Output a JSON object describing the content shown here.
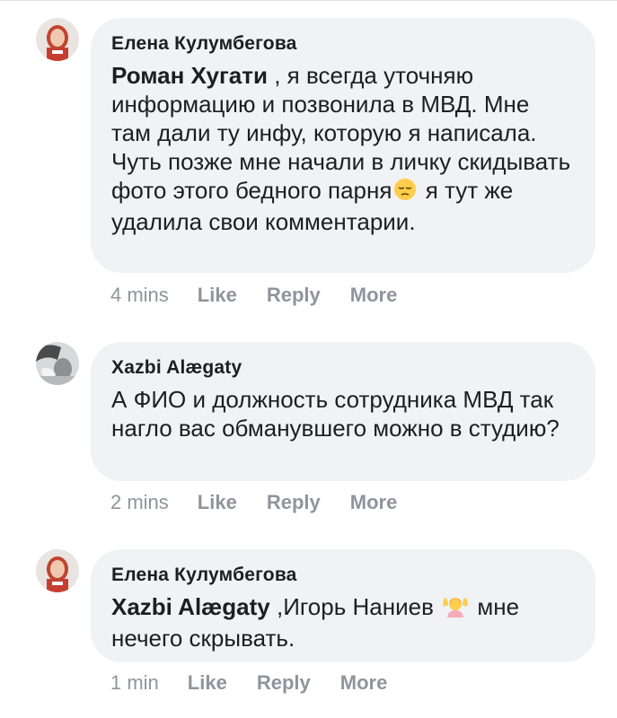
{
  "comments": [
    {
      "author": "Елена Кулумбегова",
      "mention": "Роман Хугати",
      "text_before_emoji": " , я всегда уточняю информацию и позвонила в МВД. Мне там дали ту инфу, которую я написала. Чуть позже мне начали в личку скидывать фото этого бедного парня",
      "emoji": "pensive-face",
      "text_after_emoji": " я тут же удалила свои комментарии.",
      "time": "4 mins",
      "like": "Like",
      "reply": "Reply",
      "more": "More"
    },
    {
      "author": "Xazbi Alægaty",
      "text": "А ФИО и должность сотрудника МВД так нагло вас обманувшего можно в студию?",
      "time": "2 mins",
      "like": "Like",
      "reply": "Reply",
      "more": "More"
    },
    {
      "author": "Елена Кулумбегова",
      "mention": "Xazbi Alægaty",
      "text_before_emoji": " ,Игорь Наниев ",
      "emoji": "person-raising-hands",
      "text_after_emoji": " мне нечего скрывать.",
      "time": "1 min",
      "like": "Like",
      "reply": "Reply",
      "more": "More"
    }
  ],
  "colors": {
    "bubble": "#f0f2f5",
    "text": "#1c1e21",
    "meta": "#90949c"
  }
}
